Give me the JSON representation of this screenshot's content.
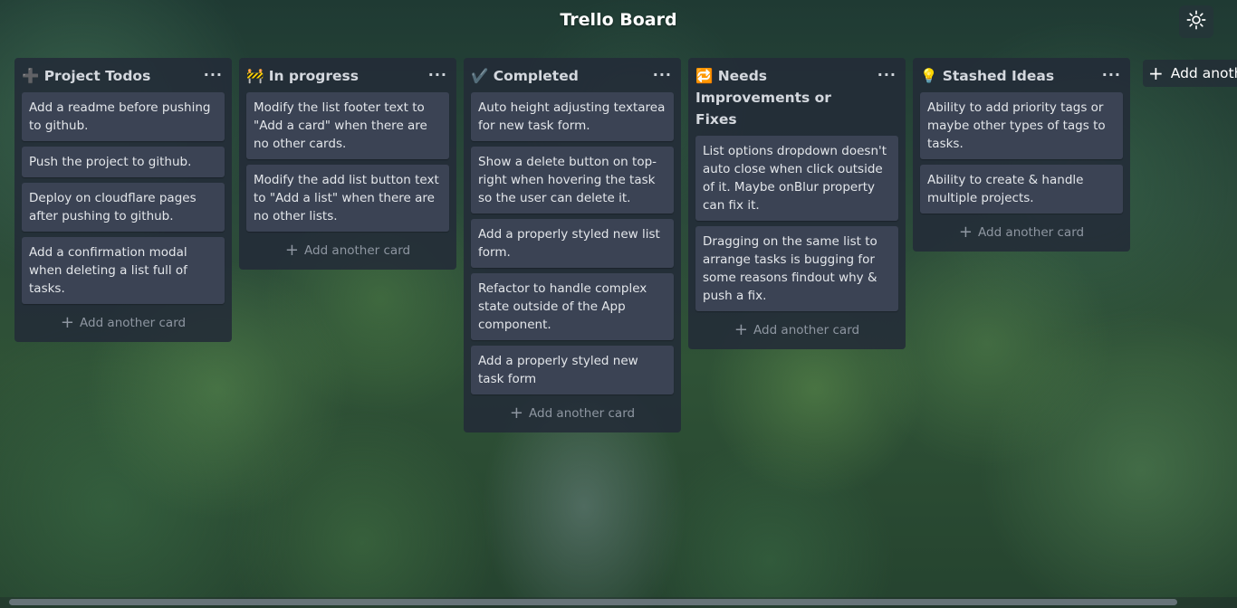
{
  "board": {
    "title": "Trello Board"
  },
  "header": {
    "theme_icon": "sun-icon"
  },
  "lists": [
    {
      "title": "➕ Project Todos",
      "menu": "···",
      "cards": [
        "Add a readme before pushing to github.",
        "Push the project to github.",
        "Deploy on cloudflare pages after pushing to github.",
        "Add a confirmation modal when deleting a list full of tasks."
      ],
      "add_card": "Add another card"
    },
    {
      "title": "🚧 In progress",
      "menu": "···",
      "cards": [
        "Modify the list footer text to \"Add a card\" when there are no other cards.",
        "Modify the add list button text to \"Add a list\" when there are no other lists."
      ],
      "add_card": "Add another card"
    },
    {
      "title": "✔️ Completed",
      "menu": "···",
      "cards": [
        "Auto height adjusting textarea for new task form.",
        "Show a delete button on top-right when hovering the task so the user can delete it.",
        "Add a properly styled new list form.",
        "Refactor to handle complex state outside of the App component.",
        "Add a properly styled new task form"
      ],
      "add_card": "Add another card"
    },
    {
      "title": "🔁 Needs Improvements or Fixes",
      "menu": "···",
      "cards": [
        "List options dropdown doesn't auto close when click outside of it. Maybe onBlur property can fix it.",
        "Dragging on the same list to arrange tasks is bugging for some reasons findout why & push a fix."
      ],
      "add_card": "Add another card"
    },
    {
      "title": "💡 Stashed Ideas",
      "menu": "···",
      "cards": [
        "Ability to add priority tags or maybe other types of tags to tasks.",
        "Ability to create & handle multiple projects."
      ],
      "add_card": "Add another card"
    }
  ],
  "add_list": {
    "label": "Add another list"
  },
  "colors": {
    "list_bg": "#232b38",
    "card_bg": "#3b4354",
    "text": "#e3e6ea",
    "muted": "#8e96a1"
  }
}
